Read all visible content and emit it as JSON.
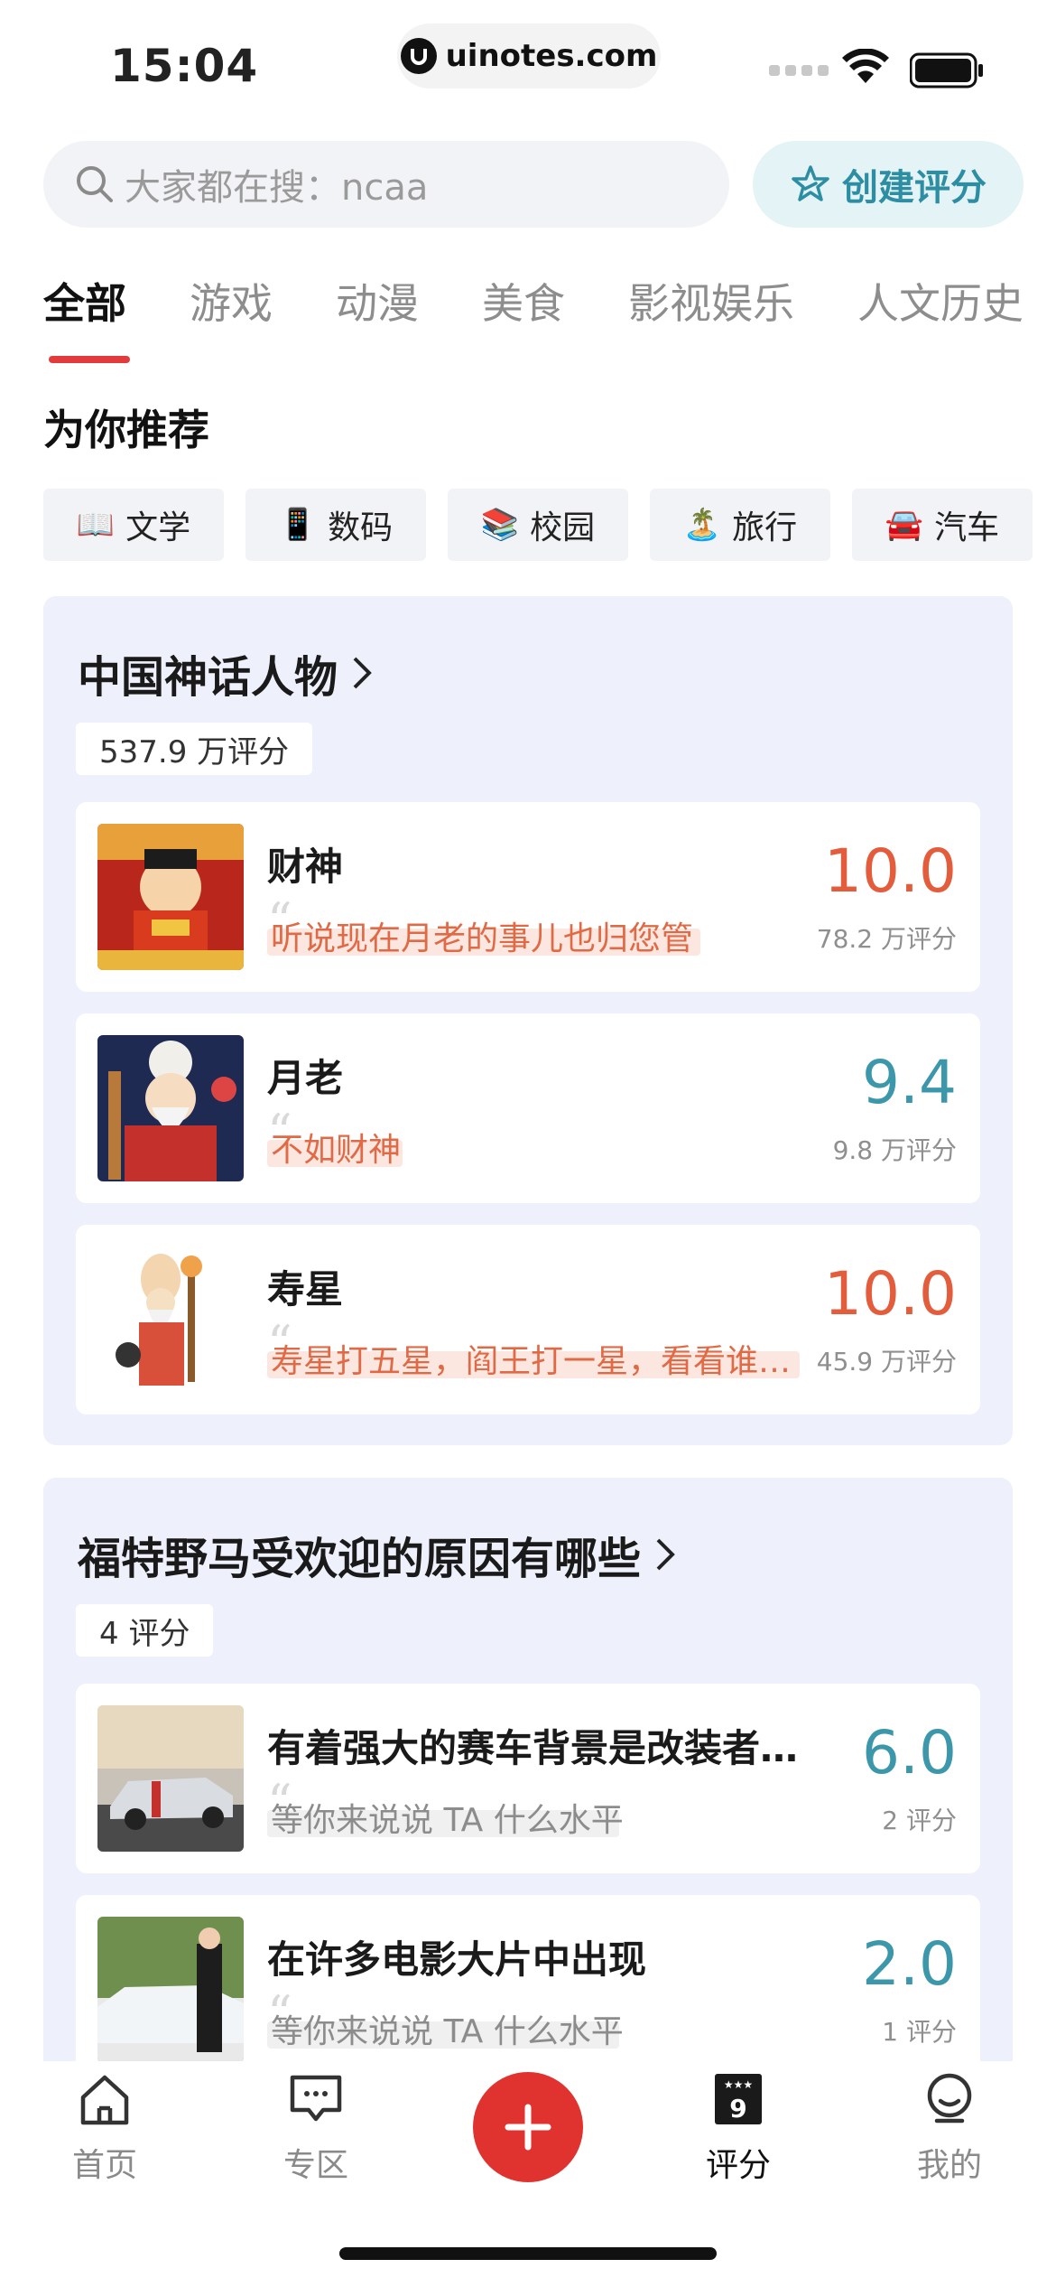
{
  "status": {
    "time": "15:04",
    "url": "uinotes.com"
  },
  "search": {
    "text": "大家都在搜：ncaa"
  },
  "create_button": {
    "label": "创建评分"
  },
  "tabs": [
    {
      "label": "全部"
    },
    {
      "label": "游戏"
    },
    {
      "label": "动漫"
    },
    {
      "label": "美食"
    },
    {
      "label": "影视娱乐"
    },
    {
      "label": "人文历史"
    }
  ],
  "recommend": {
    "title": "为你推荐",
    "chips": [
      {
        "emoji": "📖",
        "label": "文学"
      },
      {
        "emoji": "📱",
        "label": "数码"
      },
      {
        "emoji": "📚",
        "label": "校园"
      },
      {
        "emoji": "🏝️",
        "label": "旅行"
      },
      {
        "emoji": "🚘",
        "label": "汽车"
      }
    ]
  },
  "topics": [
    {
      "title": "中国神话人物",
      "count": "537.9 万评分",
      "items": [
        {
          "name": "财神",
          "quote": "听说现在月老的事儿也归您管",
          "score": "10.0",
          "ratings": "78.2 万评分"
        },
        {
          "name": "月老",
          "quote": "不如财神",
          "score": "9.4",
          "ratings": "9.8 万评分"
        },
        {
          "name": "寿星",
          "quote": "寿星打五星，阎王打一星，看看谁…",
          "score": "10.0",
          "ratings": "45.9 万评分"
        }
      ]
    },
    {
      "title": "福特野马受欢迎的原因有哪些",
      "count": "4 评分",
      "items": [
        {
          "name": "有着强大的赛车背景是改装者…",
          "quote": "等你来说说 TA 什么水平",
          "score": "6.0",
          "ratings": "2 评分"
        },
        {
          "name": "在许多电影大片中出现",
          "quote": "等你来说说 TA 什么水平",
          "score": "2.0",
          "ratings": "1 评分"
        }
      ]
    }
  ],
  "nav": {
    "home": "首页",
    "zone": "专区",
    "rating": "评分",
    "mine": "我的"
  },
  "colors": {
    "accent_red": "#e0322e",
    "score_red": "#e35d3d",
    "score_teal": "#3c97ab",
    "card_bg": "#eef1fb"
  }
}
